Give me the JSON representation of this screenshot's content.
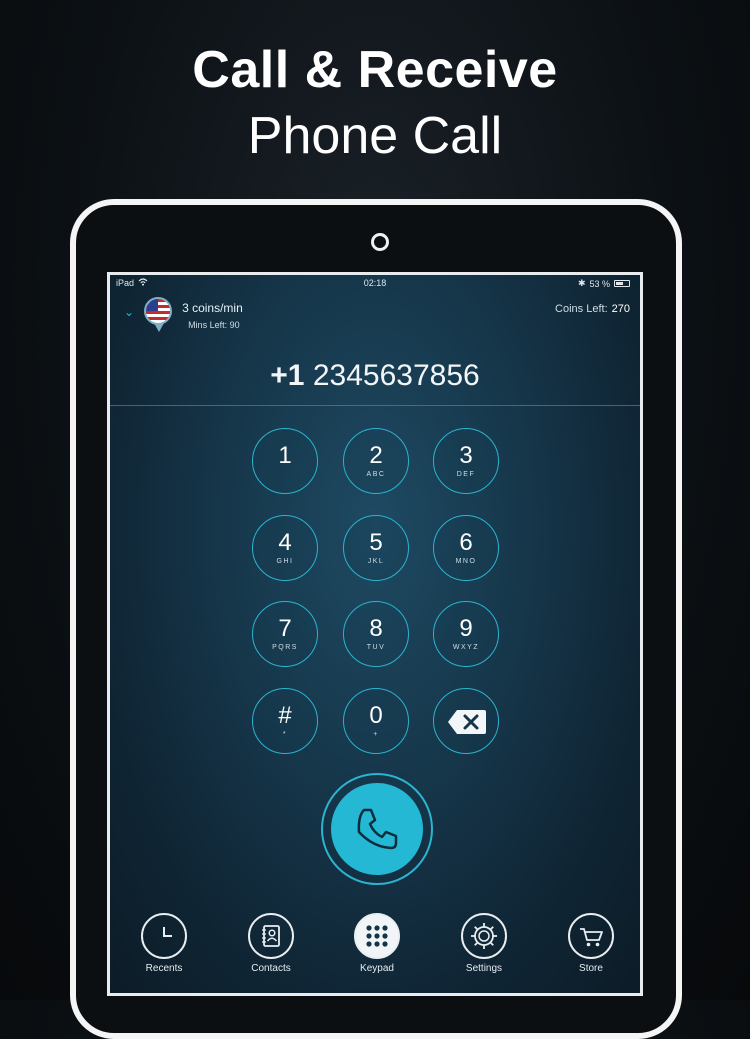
{
  "headline": {
    "bold": "Call & Receive",
    "light": "Phone Call"
  },
  "status_bar": {
    "device": "iPad",
    "time": "02:18",
    "battery": "53 %"
  },
  "rate": {
    "coins_per_min": "3 coins/min",
    "mins_left": "Mins Left: 90"
  },
  "coins_left": {
    "label": "Coins Left:",
    "value": "270"
  },
  "dialed": {
    "country_code": "+1",
    "number": "2345637856"
  },
  "keypad": [
    {
      "digit": "1",
      "letters": ""
    },
    {
      "digit": "2",
      "letters": "ABC"
    },
    {
      "digit": "3",
      "letters": "DEF"
    },
    {
      "digit": "4",
      "letters": "GHI"
    },
    {
      "digit": "5",
      "letters": "JKL"
    },
    {
      "digit": "6",
      "letters": "MNO"
    },
    {
      "digit": "7",
      "letters": "PQRS"
    },
    {
      "digit": "8",
      "letters": "TUV"
    },
    {
      "digit": "9",
      "letters": "WXYZ"
    },
    {
      "digit": "#",
      "letters": "*"
    },
    {
      "digit": "0",
      "letters": "+"
    }
  ],
  "tabs": [
    {
      "label": "Recents",
      "icon": "clock-icon"
    },
    {
      "label": "Contacts",
      "icon": "contacts-book-icon"
    },
    {
      "label": "Keypad",
      "icon": "keypad-grid-icon",
      "active": true
    },
    {
      "label": "Settings",
      "icon": "gear-icon"
    },
    {
      "label": "Store",
      "icon": "cart-icon"
    }
  ],
  "colors": {
    "accent": "#24b8d4",
    "screen_bg": "#153447"
  }
}
